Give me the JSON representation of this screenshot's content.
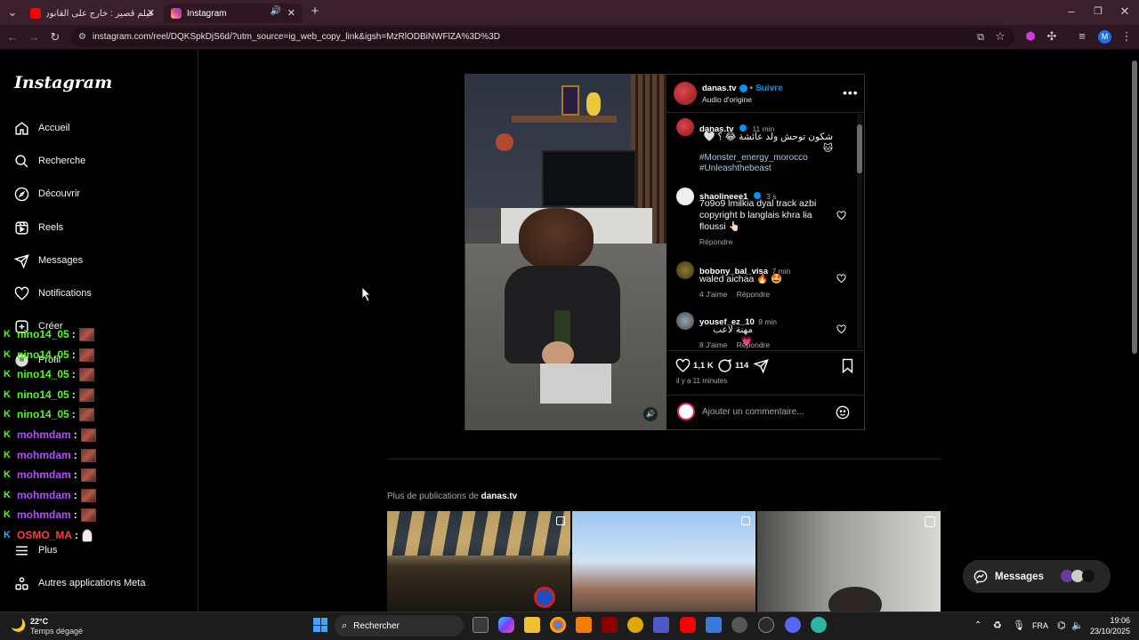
{
  "browser": {
    "tabs": [
      {
        "label": "فيلم قصير : خارج على القانون - e",
        "active": false
      },
      {
        "label": "Instagram",
        "active": true
      }
    ],
    "url": "instagram.com/reel/DQKSpkDjS6d/?utm_source=ig_web_copy_link&igsh=MzRlODBiNWFlZA%3D%3D",
    "window_controls": [
      "minimize",
      "maximize",
      "close"
    ],
    "profile_initial": "M"
  },
  "sidebar": {
    "logo": "Instagram",
    "items": [
      {
        "label": "Accueil",
        "icon": "home-icon"
      },
      {
        "label": "Recherche",
        "icon": "search-icon"
      },
      {
        "label": "Découvrir",
        "icon": "compass-icon"
      },
      {
        "label": "Reels",
        "icon": "reels-icon"
      },
      {
        "label": "Messages",
        "icon": "send-icon"
      },
      {
        "label": "Notifications",
        "icon": "heart-icon"
      },
      {
        "label": "Créer",
        "icon": "plus-square-icon"
      },
      {
        "label": "Profil",
        "icon": "avatar-icon"
      },
      {
        "label": "Plus",
        "icon": "menu-icon"
      },
      {
        "label": "Autres applications Meta",
        "icon": "apps-icon"
      }
    ]
  },
  "chat_overlay": [
    {
      "user": "nino14_05",
      "color": "#53fc18"
    },
    {
      "user": "nino14_05",
      "color": "#53fc18"
    },
    {
      "user": "nino14_05",
      "color": "#53fc18"
    },
    {
      "user": "nino14_05",
      "color": "#53fc18"
    },
    {
      "user": "nino14_05",
      "color": "#53fc18"
    },
    {
      "user": "mohmdam",
      "color": "#b44dff"
    },
    {
      "user": "mohmdam",
      "color": "#b44dff"
    },
    {
      "user": "mohmdam",
      "color": "#b44dff"
    },
    {
      "user": "mohmdam",
      "color": "#b44dff"
    },
    {
      "user": "mohmdam",
      "color": "#b44dff"
    },
    {
      "user": "OSMO_MA",
      "color": "#ff3b3b"
    }
  ],
  "post": {
    "author": "danas.tv",
    "follow": "Suivre",
    "audio": "Audio d'origine",
    "caption": {
      "user": "danas.tv",
      "time": "11 min",
      "text": "شكون توحش ولد عائشة 😂 ؟ 🤍 🐱",
      "tags": [
        "#Monster_energy_morocco",
        "#Unleashthebeast"
      ]
    },
    "comments": [
      {
        "user": "shaolineee1",
        "time": "3 s",
        "text": "7o9o9 lmilkia dyal track azbi copyright b langlais khra lia floussi 👆🏻",
        "likes": "",
        "reply": "Répondre"
      },
      {
        "user": "bobony_bal_visa",
        "time": "7 min",
        "text": "waled aichaa 🔥 🤩",
        "likes": "4 J'aime",
        "reply": "Répondre"
      },
      {
        "user": "yousef_ez_10",
        "time": "9 min",
        "text": "مهنة لاعب 💗",
        "likes": "8 J'aime",
        "reply": "Répondre"
      }
    ],
    "like_count": "1,1 K",
    "comment_count": "114",
    "timestamp": "il y a 11 minutes",
    "add_comment_placeholder": "Ajouter un commentaire..."
  },
  "more": {
    "prefix": "Plus de publications de",
    "user": "danas.tv"
  },
  "messages_float": {
    "label": "Messages"
  },
  "taskbar": {
    "weather_temp": "22°C",
    "weather_desc": "Temps dégagé",
    "search": "Rechercher",
    "lang": "FRA",
    "time": "19:06",
    "date": "23/10/2025"
  },
  "colors": {
    "accent_blue": "#0095f6",
    "tab_bg": "#3c1f2c",
    "kick_green": "#53fc18"
  }
}
